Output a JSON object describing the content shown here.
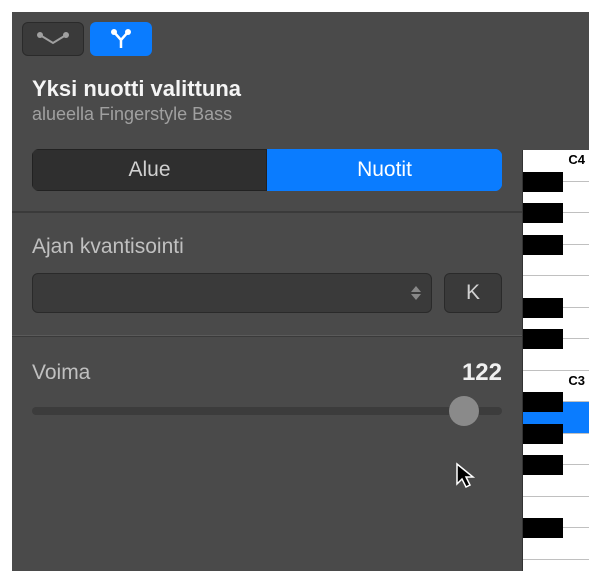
{
  "header": {
    "title": "Yksi nuotti valittuna",
    "subtitle": "alueella Fingerstyle Bass"
  },
  "segmented": {
    "region": "Alue",
    "notes": "Nuotit"
  },
  "quantize": {
    "label": "Ajan kvantisointi",
    "value": "",
    "k_button": "K"
  },
  "velocity": {
    "label": "Voima",
    "value": "122"
  },
  "piano": {
    "label_c4": "C4",
    "label_c3": "C3"
  }
}
